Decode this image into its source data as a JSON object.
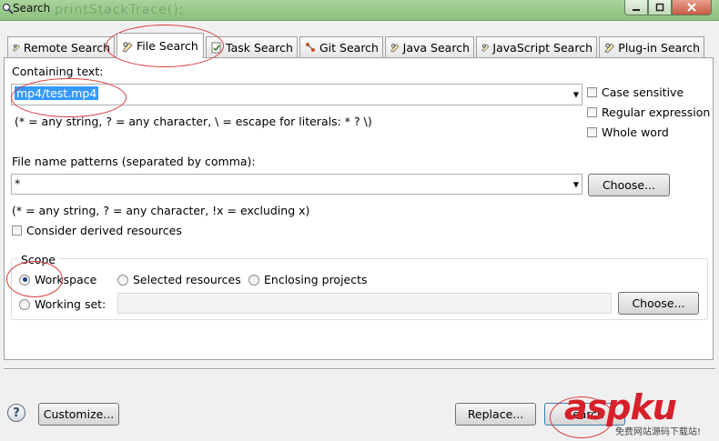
{
  "window": {
    "title": "Search",
    "ghost_text": "printStackTrace();"
  },
  "tabs": [
    {
      "label": "Remote Search"
    },
    {
      "label": "File Search"
    },
    {
      "label": "Task Search"
    },
    {
      "label": "Git Search"
    },
    {
      "label": "Java Search"
    },
    {
      "label": "JavaScript Search"
    },
    {
      "label": "Plug-in Search"
    }
  ],
  "containing": {
    "label": "Containing text:",
    "value": "mp4/test.mp4",
    "hint": "(* = any string, ? = any character, \\ = escape for literals: * ? \\)"
  },
  "options": {
    "case_sensitive": "Case sensitive",
    "regex": "Regular expression",
    "whole_word": "Whole word"
  },
  "patterns": {
    "label": "File name patterns (separated by comma):",
    "value": "*",
    "choose": "Choose...",
    "hint": "(* = any string, ? = any character, !x = excluding x)"
  },
  "derived": "Consider derived resources",
  "scope": {
    "title": "Scope",
    "workspace": "Workspace",
    "selected": "Selected resources",
    "enclosing": "Enclosing projects",
    "working_set": "Working set:",
    "choose": "Choose..."
  },
  "footer": {
    "help": "?",
    "customize": "Customize...",
    "replace": "Replace...",
    "search": "Search"
  },
  "watermark": {
    "brand": "aspku",
    "subtitle": "免费网站源码下载站!"
  }
}
